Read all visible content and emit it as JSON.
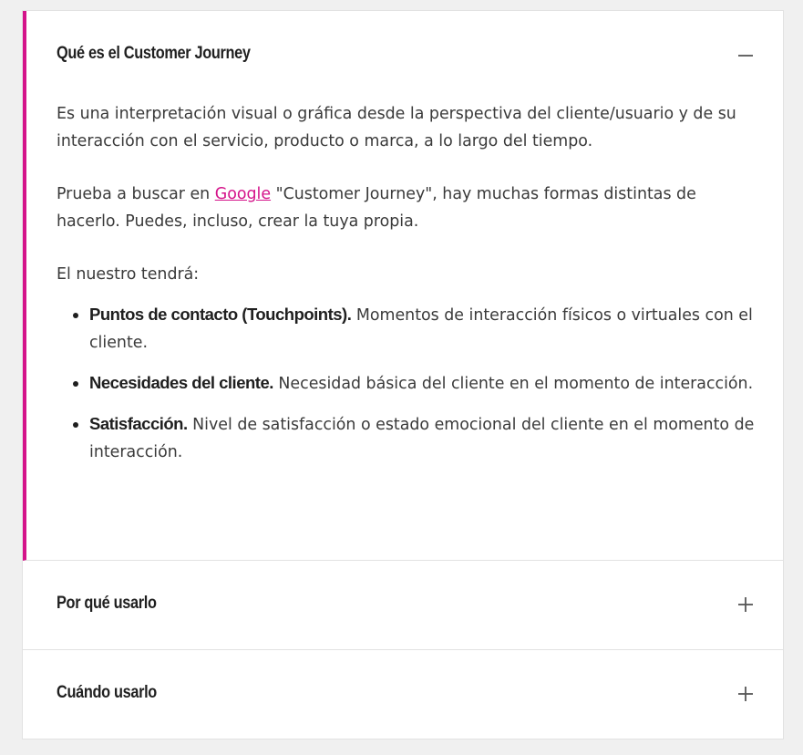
{
  "accordion": {
    "panels": [
      {
        "title": "Qué es el Customer Journey",
        "expanded": true,
        "toggle_icon": "minus-icon",
        "body": {
          "para1": "Es una interpretación visual o gráfica desde la perspectiva del cliente/usuario y de su interacción con el servicio, producto o marca, a lo largo del tiempo.",
          "para2_before": "Prueba a buscar en ",
          "para2_link": "Google",
          "para2_after": " \"Customer Journey\",  hay muchas formas distintas de hacerlo. Puedes, incluso, crear la tuya propia.",
          "para3": "El nuestro tendrá:",
          "items": [
            {
              "term": "Puntos de contacto (Touchpoints).",
              "text": " Momentos de interacción físicos o virtuales con el cliente."
            },
            {
              "term": "Necesidades del cliente.",
              "text": " Necesidad básica del cliente en el momento de interacción."
            },
            {
              "term": "Satisfacción.",
              "text": " Nivel de satisfacción o estado emocional del cliente en el momento de interacción."
            }
          ]
        }
      },
      {
        "title": "Por qué usarlo",
        "expanded": false,
        "toggle_icon": "plus-icon"
      },
      {
        "title": "Cuándo usarlo",
        "expanded": false,
        "toggle_icon": "plus-icon"
      }
    ]
  },
  "colors": {
    "accent": "#d4138a",
    "background": "#f0f0f0",
    "panel": "#ffffff"
  }
}
